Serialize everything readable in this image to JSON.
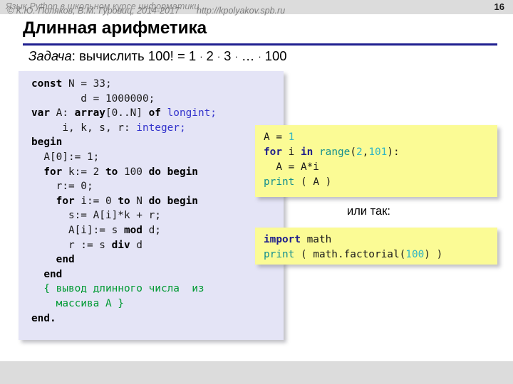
{
  "header": {
    "title": "Язык Python в школьном курсе информатики",
    "page_number": "16"
  },
  "slide": {
    "title": "Длинная арифметика",
    "rule_color": "#1f1f8f",
    "subtitle": {
      "label": "Задача",
      "colon": ": ",
      "text_before": "вычислить 100! = 1",
      "dot": "·",
      "t2": "2",
      "t3": "3",
      "ellipsis": "…",
      "t100": "100"
    }
  },
  "pascal_panel": {
    "background": "#e4e4f6",
    "lines": [
      [
        {
          "t": "const",
          "c": "kw"
        },
        {
          "t": " N = 33;",
          "c": "plain"
        }
      ],
      [
        {
          "t": "        d = 1000000;",
          "c": "plain"
        }
      ],
      [
        {
          "t": "var",
          "c": "kw"
        },
        {
          "t": " A: ",
          "c": "plain"
        },
        {
          "t": "array",
          "c": "kw"
        },
        {
          "t": "[0..N] ",
          "c": "plain"
        },
        {
          "t": "of",
          "c": "kw"
        },
        {
          "t": " ",
          "c": "plain"
        },
        {
          "t": "longint;",
          "c": "type"
        }
      ],
      [
        {
          "t": "     i, k, s, r: ",
          "c": "plain"
        },
        {
          "t": "integer;",
          "c": "type"
        }
      ],
      [
        {
          "t": "begin",
          "c": "kw"
        }
      ],
      [
        {
          "t": "  A[0]:= 1;",
          "c": "plain"
        }
      ],
      [
        {
          "t": "  ",
          "c": "plain"
        },
        {
          "t": "for",
          "c": "kw"
        },
        {
          "t": " k:= 2 ",
          "c": "plain"
        },
        {
          "t": "to",
          "c": "kw"
        },
        {
          "t": " 100 ",
          "c": "plain"
        },
        {
          "t": "do begin",
          "c": "kw"
        }
      ],
      [
        {
          "t": "    r:= 0;",
          "c": "plain"
        }
      ],
      [
        {
          "t": "    ",
          "c": "plain"
        },
        {
          "t": "for",
          "c": "kw"
        },
        {
          "t": " i:= 0 ",
          "c": "plain"
        },
        {
          "t": "to",
          "c": "kw"
        },
        {
          "t": " N ",
          "c": "plain"
        },
        {
          "t": "do begin",
          "c": "kw"
        }
      ],
      [
        {
          "t": "      s:= A[i]*k + r;",
          "c": "plain"
        }
      ],
      [
        {
          "t": "      A[i]:= s ",
          "c": "plain"
        },
        {
          "t": "mod",
          "c": "kw"
        },
        {
          "t": " d;",
          "c": "plain"
        }
      ],
      [
        {
          "t": "      r := s ",
          "c": "plain"
        },
        {
          "t": "div",
          "c": "kw"
        },
        {
          "t": " d",
          "c": "plain"
        }
      ],
      [
        {
          "t": "    ",
          "c": "plain"
        },
        {
          "t": "end",
          "c": "kw"
        }
      ],
      [
        {
          "t": "  ",
          "c": "plain"
        },
        {
          "t": "end",
          "c": "kw"
        }
      ],
      [
        {
          "t": "  { вывод длинного числа  из",
          "c": "comment"
        }
      ],
      [
        {
          "t": "    массива A }",
          "c": "comment"
        }
      ],
      [
        {
          "t": "end.",
          "c": "kw"
        }
      ]
    ]
  },
  "python_panel_1": {
    "background": "#fbfb95",
    "lines": [
      [
        {
          "t": "A = ",
          "c": "plain"
        },
        {
          "t": "1",
          "c": "pynum"
        }
      ],
      [
        {
          "t": "for",
          "c": "pykw"
        },
        {
          "t": " i ",
          "c": "plain"
        },
        {
          "t": "in",
          "c": "pykw"
        },
        {
          "t": " ",
          "c": "plain"
        },
        {
          "t": "range",
          "c": "pyteal"
        },
        {
          "t": "(",
          "c": "plain"
        },
        {
          "t": "2",
          "c": "pynum"
        },
        {
          "t": ",",
          "c": "plain"
        },
        {
          "t": "101",
          "c": "pynum"
        },
        {
          "t": "):",
          "c": "plain"
        }
      ],
      [
        {
          "t": "  A = A*i",
          "c": "plain"
        }
      ],
      [
        {
          "t": "print",
          "c": "pyteal"
        },
        {
          "t": " ( A )",
          "c": "plain"
        }
      ]
    ]
  },
  "python_panel_2": {
    "background": "#fbfb95",
    "lines": [
      [
        {
          "t": "import",
          "c": "pykw"
        },
        {
          "t": " math",
          "c": "plain"
        }
      ],
      [
        {
          "t": "print",
          "c": "pyteal"
        },
        {
          "t": " ( math.factorial(",
          "c": "plain"
        },
        {
          "t": "100",
          "c": "pynum"
        },
        {
          "t": ") )",
          "c": "plain"
        }
      ]
    ]
  },
  "alt_note": {
    "text": "или так:"
  },
  "footer": {
    "copyright": "© К.Ю. Поляков, В.М. Гуровиц, 2014-2017",
    "url": "http://kpolyakov.spb.ru"
  }
}
